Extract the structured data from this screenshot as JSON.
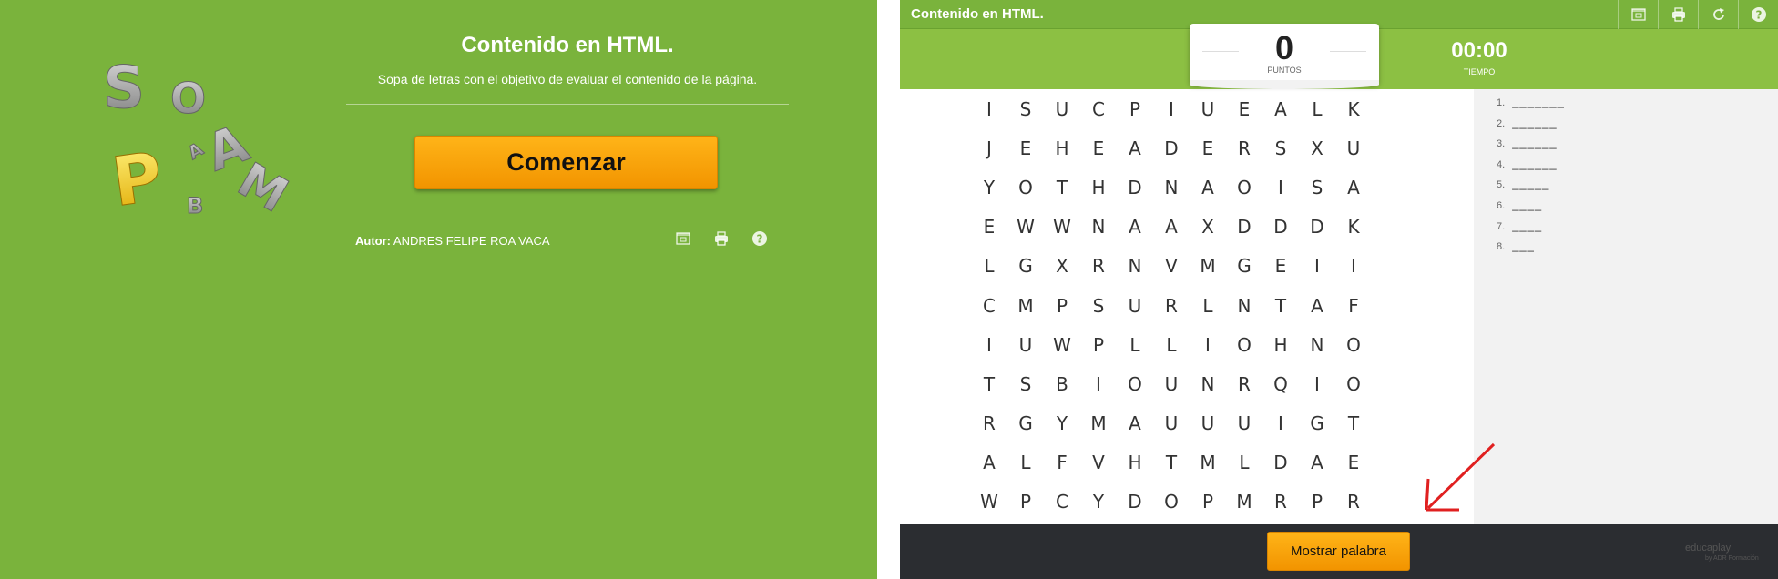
{
  "left": {
    "title": "Contenido en HTML.",
    "subtitle": "Sopa de letras con el objetivo de evaluar el contenido de la página.",
    "start_label": "Comenzar",
    "author_label": "Autor:",
    "author_name": "ANDRES FELIPE ROA VACA",
    "logo_letters": [
      "S",
      "O",
      "P",
      "A",
      "B",
      "A",
      "M"
    ],
    "icons": [
      "fullscreen-icon",
      "print-icon",
      "help-icon"
    ]
  },
  "right": {
    "title": "Contenido en HTML.",
    "toolbar_icons": [
      "fullscreen-icon",
      "print-icon",
      "restart-icon",
      "help-icon"
    ],
    "score": {
      "value": "0",
      "label": "PUNTOS"
    },
    "time": {
      "value": "00:00",
      "label": "TIEMPO"
    },
    "grid": [
      [
        "I",
        "S",
        "U",
        "C",
        "P",
        "I",
        "U",
        "E",
        "A",
        "L",
        "K"
      ],
      [
        "J",
        "E",
        "H",
        "E",
        "A",
        "D",
        "E",
        "R",
        "S",
        "X",
        "U"
      ],
      [
        "Y",
        "O",
        "T",
        "H",
        "D",
        "N",
        "A",
        "O",
        "I",
        "S",
        "A"
      ],
      [
        "E",
        "W",
        "W",
        "N",
        "A",
        "A",
        "X",
        "D",
        "D",
        "D",
        "K"
      ],
      [
        "L",
        "G",
        "X",
        "R",
        "N",
        "V",
        "M",
        "G",
        "E",
        "I",
        "I"
      ],
      [
        "C",
        "M",
        "P",
        "S",
        "U",
        "R",
        "L",
        "N",
        "T",
        "A",
        "F"
      ],
      [
        "I",
        "U",
        "W",
        "P",
        "L",
        "L",
        "I",
        "O",
        "H",
        "N",
        "O"
      ],
      [
        "T",
        "S",
        "B",
        "I",
        "O",
        "U",
        "N",
        "R",
        "Q",
        "I",
        "O"
      ],
      [
        "R",
        "G",
        "Y",
        "M",
        "A",
        "U",
        "U",
        "U",
        "I",
        "G",
        "T"
      ],
      [
        "A",
        "L",
        "F",
        "V",
        "H",
        "T",
        "M",
        "L",
        "D",
        "A",
        "E"
      ],
      [
        "W",
        "P",
        "C",
        "Y",
        "D",
        "O",
        "P",
        "M",
        "R",
        "P",
        "R"
      ]
    ],
    "words": [
      {
        "num": "1.",
        "blank": "_______"
      },
      {
        "num": "2.",
        "blank": "______"
      },
      {
        "num": "3.",
        "blank": "______"
      },
      {
        "num": "4.",
        "blank": "______"
      },
      {
        "num": "5.",
        "blank": "_____"
      },
      {
        "num": "6.",
        "blank": "____"
      },
      {
        "num": "7.",
        "blank": "____"
      },
      {
        "num": "8.",
        "blank": "___"
      }
    ],
    "show_word_label": "Mostrar palabra",
    "brand": "educaplay",
    "brand_sub": "by ADR Formación",
    "colors": {
      "green": "#7ab33c",
      "orange": "#f5a00a",
      "dark": "#2b2d31",
      "arrow": "#e02020"
    }
  }
}
